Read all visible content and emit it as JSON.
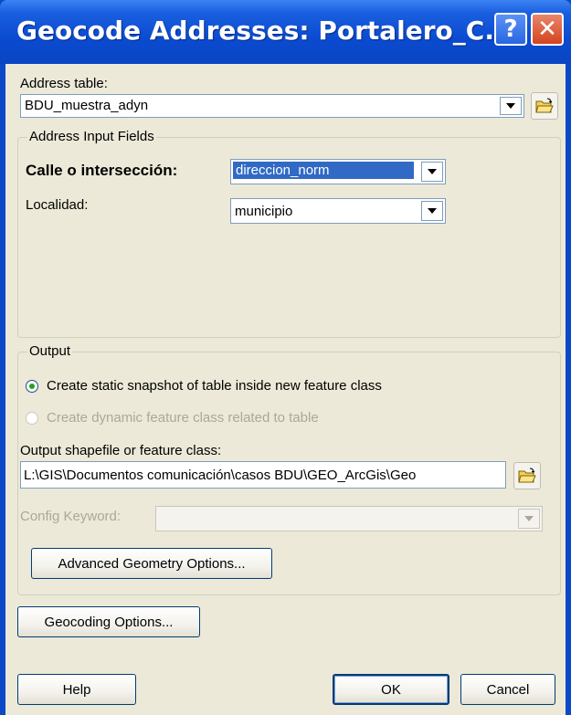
{
  "window": {
    "title": "Geocode Addresses:  Portalero_C...",
    "help_glyph": "?",
    "close_glyph": "✕"
  },
  "address_table": {
    "label": "Address table:",
    "value": "BDU_muestra_adyn"
  },
  "address_input_fields": {
    "legend": "Address Input Fields",
    "street": {
      "label": "Calle o intersección:",
      "value": "direccion_norm"
    },
    "locality": {
      "label": "Localidad:",
      "value": "municipio"
    }
  },
  "output": {
    "legend": "Output",
    "option_static": "Create static snapshot of table inside new feature class",
    "option_dynamic": "Create dynamic feature class related to table",
    "output_label": "Output shapefile or feature class:",
    "output_value": "L:\\GIS\\Documentos comunicación\\casos BDU\\GEO_ArcGis\\Geo",
    "config_label": "Config Keyword:",
    "config_value": "",
    "advanced_button": "Advanced Geometry Options..."
  },
  "buttons": {
    "geocoding_options": "Geocoding Options...",
    "help": "Help",
    "ok": "OK",
    "cancel": "Cancel"
  },
  "colors": {
    "title_bar": "#0a45c4",
    "dialog_face": "#ece9d8",
    "selection": "#316ac5"
  }
}
